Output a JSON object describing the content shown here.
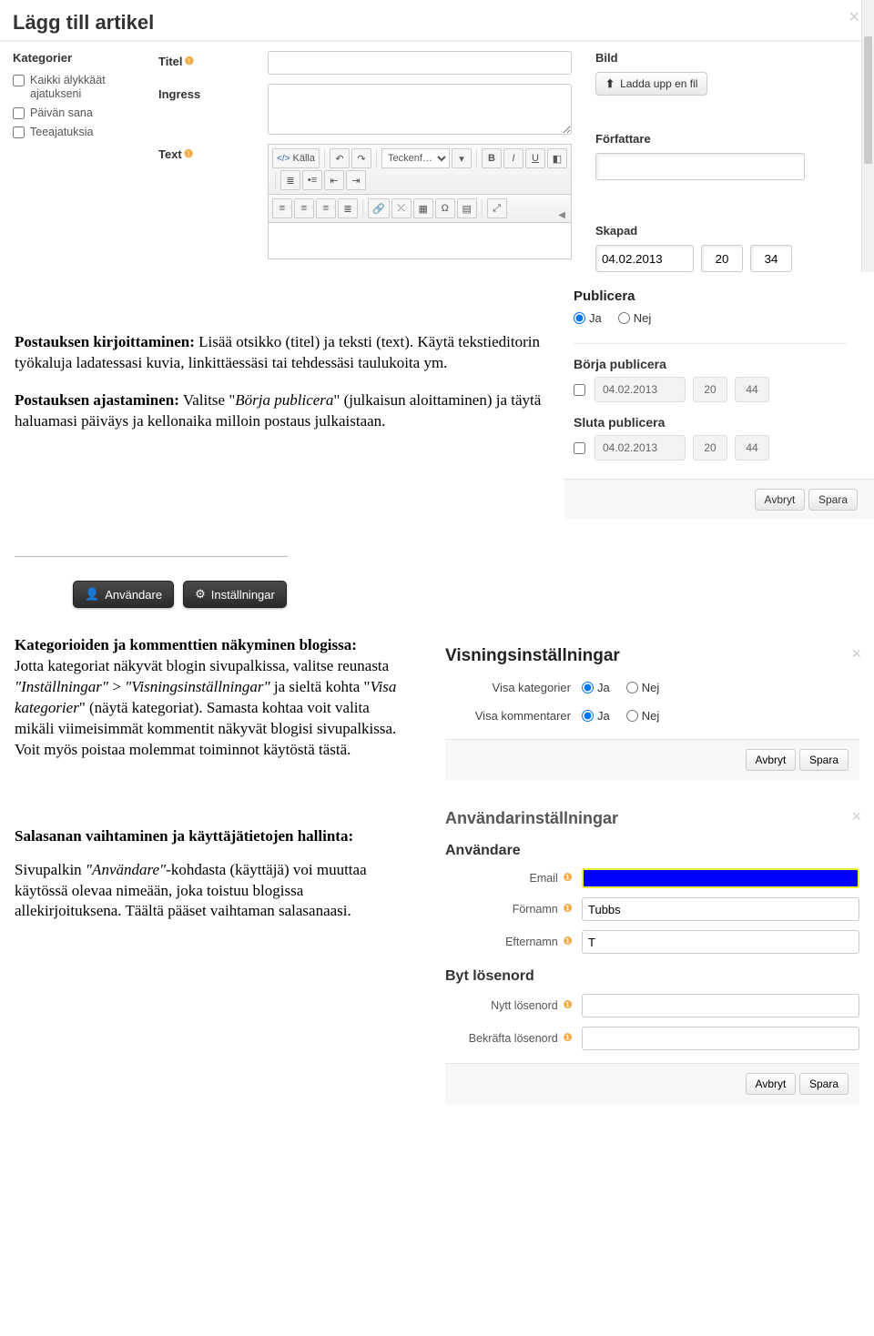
{
  "dialog": {
    "title": "Lägg till artikel",
    "cat_label": "Kategorier",
    "categories": [
      "Kaikki älykkäät ajatukseni",
      "Päivän sana",
      "Teeajatuksia"
    ],
    "titel_label": "Titel",
    "ingress_label": "Ingress",
    "text_label": "Text",
    "editor": {
      "source": "Källa",
      "font_select": "Teckenf…",
      "font_caret": "▾"
    },
    "bild_label": "Bild",
    "upload_btn": "Ladda upp en fil",
    "author_label": "Författare",
    "created_label": "Skapad",
    "created_date": "04.02.2013",
    "created_hh": "20",
    "created_mm": "34",
    "publish_header": "Publicera",
    "yes": "Ja",
    "no": "Nej",
    "start_pub": "Börja publicera",
    "end_pub": "Sluta publicera",
    "sched_date": "04.02.2013",
    "sched_hh": "20",
    "sched_mm": "44",
    "cancel": "Avbryt",
    "save": "Spara"
  },
  "para1": {
    "h1_bold": "Postauksen kirjoittaminen:",
    "h1_rest": " Lisää otsikko (titel) ja teksti (text). Käytä tekstieditorin työkaluja ladatessasi kuvia, linkittäessäsi tai tehdessäsi taulukoita ym.",
    "h2_bold": "Postauksen ajastaminen:",
    "h2_rest1": " Valitse \"",
    "h2_em": "Börja publicera",
    "h2_rest2": "\" (julkaisun aloittaminen) ja täytä haluamasi päiväys ja kellonaika milloin postaus julkaistaan."
  },
  "darkbuttons": {
    "user": "Användare",
    "settings": "Inställningar"
  },
  "para2": {
    "bold": "Kategorioiden ja kommenttien näkyminen blogissa:",
    "p1a": "Jotta kategoriat näkyvät blogin sivupalkissa, valitse reunasta ",
    "e1": "\"Inställningar\"",
    "p1b": " > ",
    "e2": "\"Visningsinställningar\"",
    "p1c": " ja sieltä kohta \"",
    "e3": "Visa kategorier",
    "p1d": "\" (näytä kategoriat). Samasta kohtaa voit valita mikäli viimeisimmät kommentit näkyvät blogisi sivupalkissa. Voit myös poistaa molemmat toiminnot käytöstä tästä."
  },
  "para3": {
    "bold": "Salasanan vaihtaminen ja käyttäjätietojen hallinta:",
    "p1a": "Sivupalkin ",
    "e1": "\"Användare\"",
    "p1b": "-kohdasta (käyttäjä) voi muuttaa käytössä olevaa nimeään, joka toistuu blogissa allekirjoituksena. Täältä pääset vaihtaman salasanaasi."
  },
  "vset": {
    "title": "Visningsinställningar",
    "row1": "Visa kategorier",
    "row2": "Visa kommentarer",
    "yes": "Ja",
    "no": "Nej",
    "cancel": "Avbryt",
    "save": "Spara"
  },
  "uset": {
    "title": "Användarinställningar",
    "sub1": "Användare",
    "email_lbl": "Email",
    "fornamn_lbl": "Förnamn",
    "fornamn_val": "Tubbs",
    "efternamn_lbl": "Efternamn",
    "efternamn_val": "T",
    "sub2": "Byt lösenord",
    "newpw_lbl": "Nytt lösenord",
    "confirmpw_lbl": "Bekräfta lösenord",
    "cancel": "Avbryt",
    "save": "Spara"
  }
}
